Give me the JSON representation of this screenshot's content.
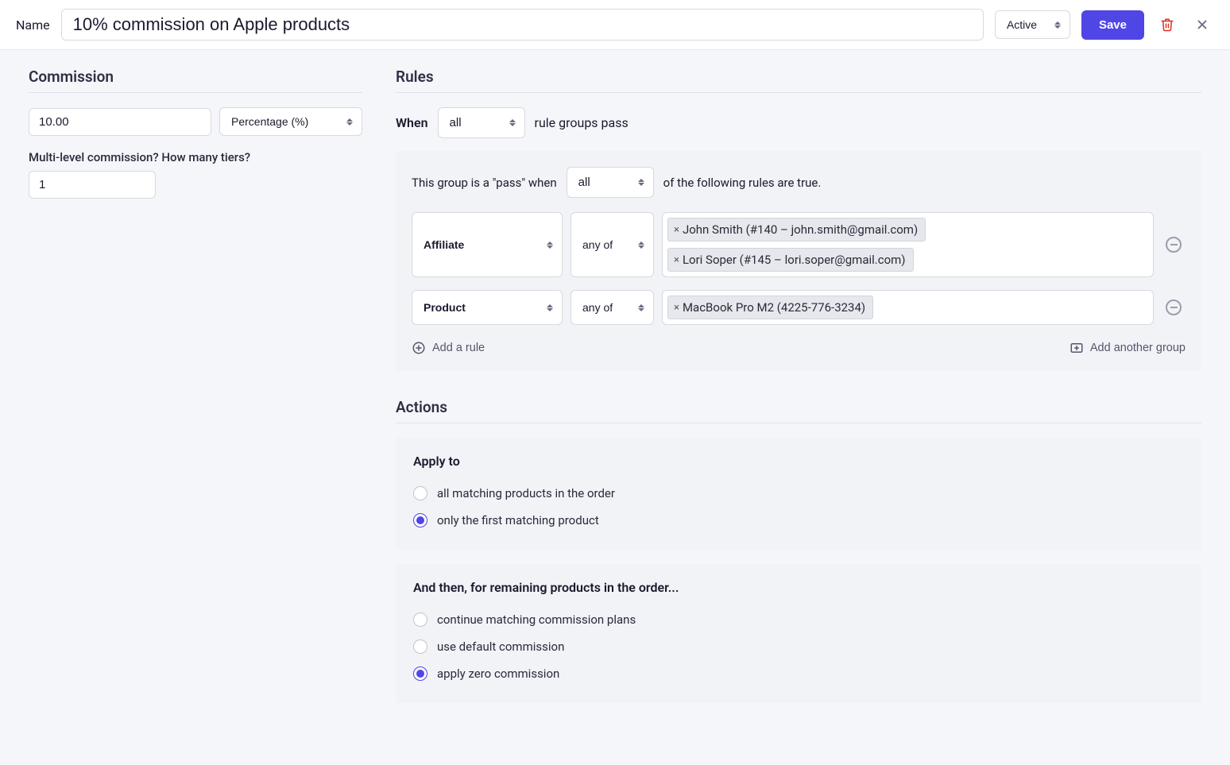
{
  "header": {
    "name_label": "Name",
    "name_value": "10% commission on Apple products",
    "status": "Active",
    "save_label": "Save"
  },
  "commission": {
    "section_title": "Commission",
    "amount": "10.00",
    "type": "Percentage (%)",
    "tiers_label": "Multi-level commission? How many tiers?",
    "tiers": "1"
  },
  "rules": {
    "section_title": "Rules",
    "when_label": "When",
    "when_condition": "all",
    "when_tail": "rule groups pass",
    "group": {
      "pass_prefix": "This group is a \"pass\" when",
      "pass_condition": "all",
      "pass_suffix": "of the following rules are true.",
      "rows": [
        {
          "attribute": "Affiliate",
          "condition": "any of",
          "values": [
            "John Smith (#140 – john.smith@gmail.com)",
            "Lori Soper (#145 – lori.soper@gmail.com)"
          ]
        },
        {
          "attribute": "Product",
          "condition": "any of",
          "values": [
            "MacBook Pro M2 (4225-776-3234)"
          ]
        }
      ],
      "add_rule_label": "Add a rule",
      "add_group_label": "Add another group"
    }
  },
  "actions": {
    "section_title": "Actions",
    "apply_to": {
      "heading": "Apply to",
      "options": [
        "all matching products in the order",
        "only the first matching product"
      ],
      "selected": 1
    },
    "remaining": {
      "heading": "And then, for remaining products in the order...",
      "options": [
        "continue matching commission plans",
        "use default commission",
        "apply zero commission"
      ],
      "selected": 2
    }
  }
}
